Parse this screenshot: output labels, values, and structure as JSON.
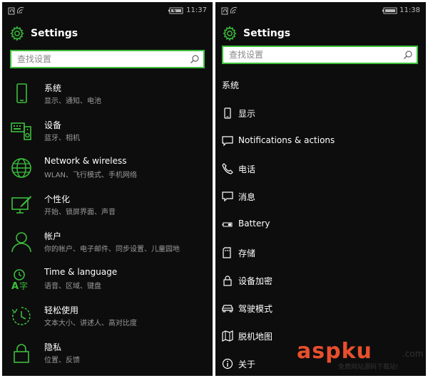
{
  "left": {
    "status": {
      "time": "11:37"
    },
    "header": {
      "title": "Settings"
    },
    "search": {
      "placeholder": "查找设置"
    },
    "categories": [
      {
        "title": "系统",
        "subtitle": "显示、通知、电池",
        "icon": "phone-icon"
      },
      {
        "title": "设备",
        "subtitle": "蓝牙、相机",
        "icon": "devices-icon"
      },
      {
        "title": "Network & wireless",
        "subtitle": "WLAN、飞行模式、手机网络",
        "icon": "globe-icon"
      },
      {
        "title": "个性化",
        "subtitle": "开始、锁屏界面、声音",
        "icon": "personalization-icon"
      },
      {
        "title": "帐户",
        "subtitle": "你的帐户、电子邮件、同步设置、儿童园地",
        "icon": "person-icon"
      },
      {
        "title": "Time & language",
        "subtitle": "语音、区域、键盘",
        "icon": "time-language-icon"
      },
      {
        "title": "轻松使用",
        "subtitle": "文本大小、讲述人、高对比度",
        "icon": "ease-of-access-icon"
      },
      {
        "title": "隐私",
        "subtitle": "位置、反馈",
        "icon": "lock-icon"
      }
    ]
  },
  "right": {
    "status": {
      "time": "11:38"
    },
    "header": {
      "title": "Settings"
    },
    "search": {
      "placeholder": "查找设置"
    },
    "section_title": "系统",
    "items": [
      {
        "label": "显示",
        "icon": "display-icon"
      },
      {
        "label": "Notifications & actions",
        "icon": "notification-icon"
      },
      {
        "label": "电话",
        "icon": "phone-call-icon"
      },
      {
        "label": "消息",
        "icon": "message-icon"
      },
      {
        "label": "Battery",
        "icon": "battery-icon"
      },
      {
        "label": "存储",
        "icon": "storage-icon"
      },
      {
        "label": "设备加密",
        "icon": "lock-icon"
      },
      {
        "label": "驾驶模式",
        "icon": "car-icon"
      },
      {
        "label": "脱机地图",
        "icon": "map-icon"
      },
      {
        "label": "关于",
        "icon": "info-icon"
      }
    ]
  },
  "watermark": {
    "brand": "aspku",
    "tld": ".com",
    "tagline": "免费网站源码下载站!"
  },
  "colors": {
    "accent": "#3cbf3c",
    "background": "#0d0d0d",
    "subtitle": "#9a9a9a"
  }
}
